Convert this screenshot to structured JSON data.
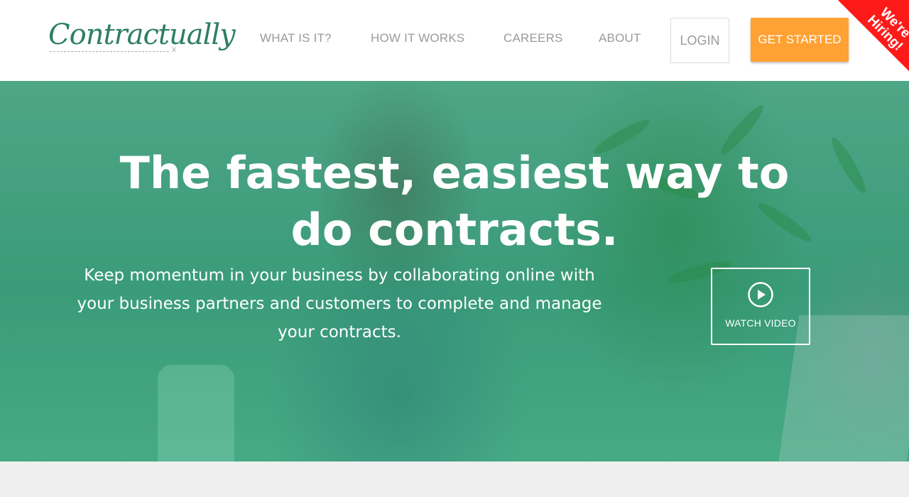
{
  "brand": {
    "logo_text": "Contractually",
    "logo_tm": "™",
    "logo_x": "x"
  },
  "nav": {
    "items": [
      {
        "label": "WHAT IS IT?"
      },
      {
        "label": "HOW IT WORKS"
      },
      {
        "label": "CAREERS"
      },
      {
        "label": "ABOUT"
      }
    ],
    "login_label": "LOGIN",
    "get_started_label": "GET STARTED"
  },
  "ribbon": {
    "line1": "We're",
    "line2": "Hiring!"
  },
  "hero": {
    "headline": "The fastest, easiest way to do contracts.",
    "subtext": "Keep momentum in your business by collaborating online with your business partners and customers to complete and manage your contracts.",
    "watch_video_label": "WATCH VIDEO",
    "play_icon": "play-circle-icon"
  },
  "colors": {
    "brand_green": "#2e7f62",
    "accent_orange": "#ffa233",
    "ribbon_red": "#ff1a1a",
    "nav_gray": "#9a9a9a"
  }
}
